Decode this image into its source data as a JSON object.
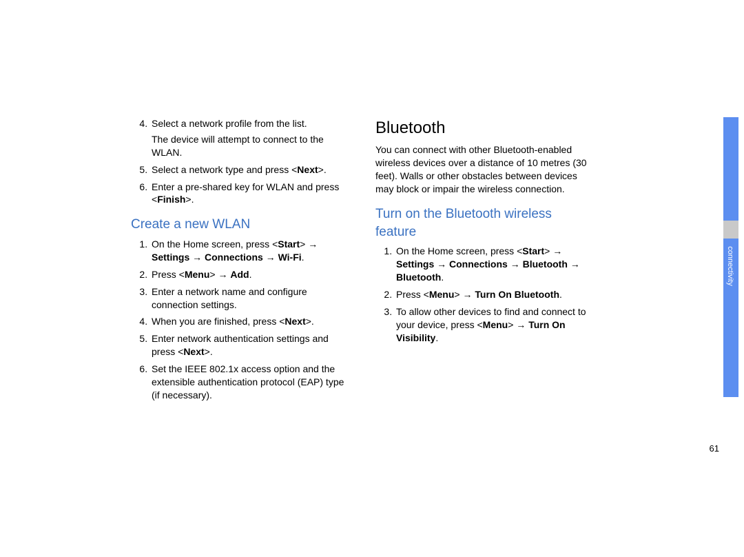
{
  "col1": {
    "list1": [
      "Select a network profile from the list.",
      "Select a network type and press <Next>.",
      "Enter a pre-shared key for WLAN and press <Finish>."
    ],
    "list1_extra": "The device will attempt to connect to the WLAN.",
    "heading": "Create a new WLAN",
    "list2": [
      "On the Home screen, press <Start> → Settings → Connections → Wi-Fi.",
      "Press <Menu> → Add.",
      "Enter a network name and configure connection settings.",
      "When you are finished, press <Next>.",
      "Enter network authentication settings and press <Next>.",
      "Set the IEEE 802.1x access option and the extensible authentication protocol (EAP) type (if necessary)."
    ]
  },
  "col2": {
    "heading_main": "Bluetooth",
    "intro": "You can connect with other Bluetooth-enabled wireless devices over a distance of 10 metres (30 feet). Walls or other obstacles between devices may block or impair the wireless connection.",
    "heading_sub": "Turn on the Bluetooth wireless feature",
    "list": [
      "On the Home screen, press <Start> → Settings → Connections → Bluetooth → Bluetooth.",
      "Press <Menu> → Turn On Bluetooth.",
      "To allow other devices to find and connect to your device, press <Menu> → Turn On Visibility."
    ]
  },
  "tab_label": "connectivity",
  "page_number": "61"
}
